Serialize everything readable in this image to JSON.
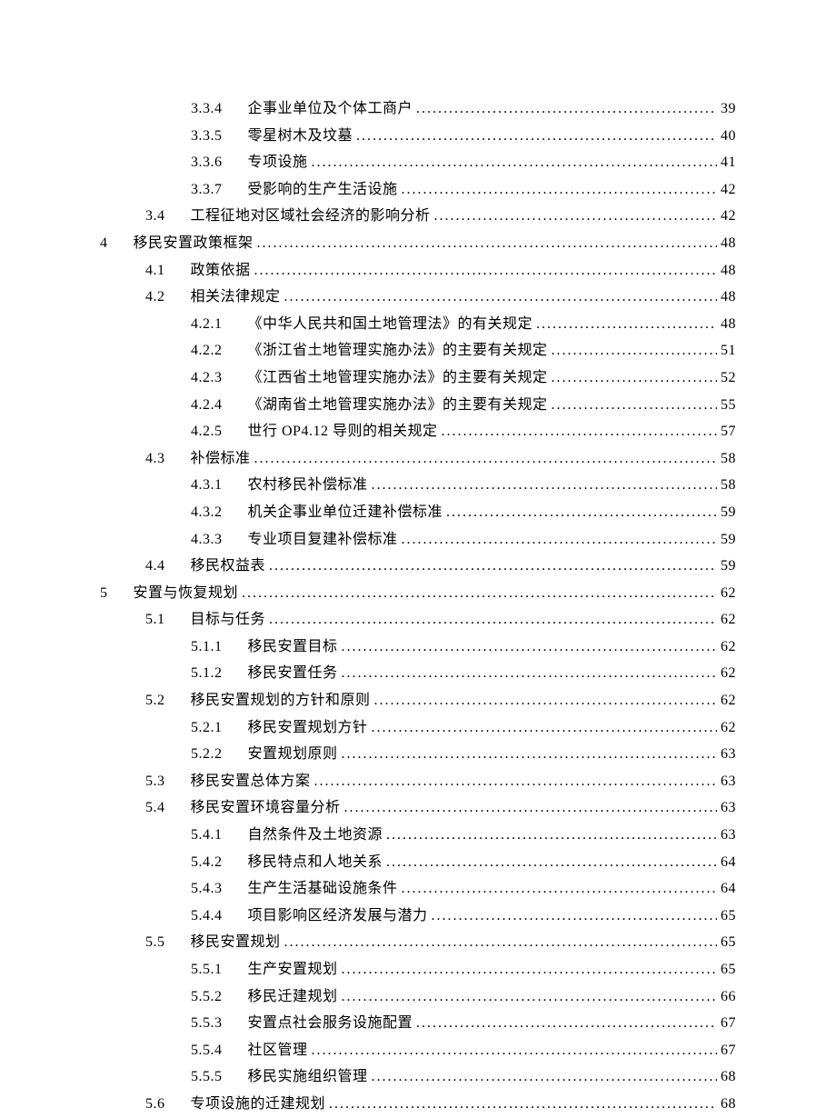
{
  "toc": [
    {
      "level": 3,
      "num": "3.3.4",
      "title": "企事业单位及个体工商户",
      "page": "39"
    },
    {
      "level": 3,
      "num": "3.3.5",
      "title": "零星树木及坟墓",
      "page": "40"
    },
    {
      "level": 3,
      "num": "3.3.6",
      "title": "专项设施",
      "page": "41"
    },
    {
      "level": 3,
      "num": "3.3.7",
      "title": "受影响的生产生活设施",
      "page": "42"
    },
    {
      "level": 2,
      "num": "3.4",
      "title": "工程征地对区域社会经济的影响分析",
      "page": "42"
    },
    {
      "level": 1,
      "num": "4",
      "title": "移民安置政策框架",
      "page": "48"
    },
    {
      "level": 2,
      "num": "4.1",
      "title": "政策依据",
      "page": "48"
    },
    {
      "level": 2,
      "num": "4.2",
      "title": "相关法律规定",
      "page": "48"
    },
    {
      "level": 3,
      "num": "4.2.1",
      "title": "《中华人民共和国土地管理法》的有关规定",
      "page": "48"
    },
    {
      "level": 3,
      "num": "4.2.2",
      "title": "《浙江省土地管理实施办法》的主要有关规定",
      "page": "51"
    },
    {
      "level": 3,
      "num": "4.2.3",
      "title": "《江西省土地管理实施办法》的主要有关规定",
      "page": "52"
    },
    {
      "level": 3,
      "num": "4.2.4",
      "title": "《湖南省土地管理实施办法》的主要有关规定",
      "page": "55"
    },
    {
      "level": 3,
      "num": "4.2.5",
      "title": "世行 OP4.12 导则的相关规定",
      "page": "57"
    },
    {
      "level": 2,
      "num": "4.3",
      "title": "补偿标准",
      "page": "58"
    },
    {
      "level": 3,
      "num": "4.3.1",
      "title": "农村移民补偿标准",
      "page": "58"
    },
    {
      "level": 3,
      "num": "4.3.2",
      "title": "机关企事业单位迁建补偿标准",
      "page": "59"
    },
    {
      "level": 3,
      "num": "4.3.3",
      "title": "专业项目复建补偿标准",
      "page": "59"
    },
    {
      "level": 2,
      "num": "4.4",
      "title": "移民权益表",
      "page": "59"
    },
    {
      "level": 1,
      "num": "5",
      "title": "安置与恢复规划",
      "page": "62"
    },
    {
      "level": 2,
      "num": "5.1",
      "title": "目标与任务",
      "page": "62"
    },
    {
      "level": 3,
      "num": "5.1.1",
      "title": "移民安置目标",
      "page": "62"
    },
    {
      "level": 3,
      "num": "5.1.2",
      "title": "移民安置任务",
      "page": "62"
    },
    {
      "level": 2,
      "num": "5.2",
      "title": "移民安置规划的方针和原则",
      "page": "62"
    },
    {
      "level": 3,
      "num": "5.2.1",
      "title": "移民安置规划方针",
      "page": "62"
    },
    {
      "level": 3,
      "num": "5.2.2",
      "title": "安置规划原则",
      "page": "63"
    },
    {
      "level": 2,
      "num": "5.3",
      "title": "移民安置总体方案",
      "page": "63"
    },
    {
      "level": 2,
      "num": "5.4",
      "title": "移民安置环境容量分析",
      "page": "63"
    },
    {
      "level": 3,
      "num": "5.4.1",
      "title": "自然条件及土地资源",
      "page": "63"
    },
    {
      "level": 3,
      "num": "5.4.2",
      "title": "移民特点和人地关系",
      "page": "64"
    },
    {
      "level": 3,
      "num": "5.4.3",
      "title": "生产生活基础设施条件",
      "page": "64"
    },
    {
      "level": 3,
      "num": "5.4.4",
      "title": "项目影响区经济发展与潜力",
      "page": "65"
    },
    {
      "level": 2,
      "num": "5.5",
      "title": "移民安置规划",
      "page": "65"
    },
    {
      "level": 3,
      "num": "5.5.1",
      "title": "生产安置规划",
      "page": "65"
    },
    {
      "level": 3,
      "num": "5.5.2",
      "title": "移民迁建规划",
      "page": "66"
    },
    {
      "level": 3,
      "num": "5.5.3",
      "title": "安置点社会服务设施配置",
      "page": "67"
    },
    {
      "level": 3,
      "num": "5.5.4",
      "title": "社区管理",
      "page": "67"
    },
    {
      "level": 3,
      "num": "5.5.5",
      "title": "移民实施组织管理",
      "page": "68"
    },
    {
      "level": 2,
      "num": "5.6",
      "title": "专项设施的迁建规划",
      "page": "68"
    }
  ]
}
